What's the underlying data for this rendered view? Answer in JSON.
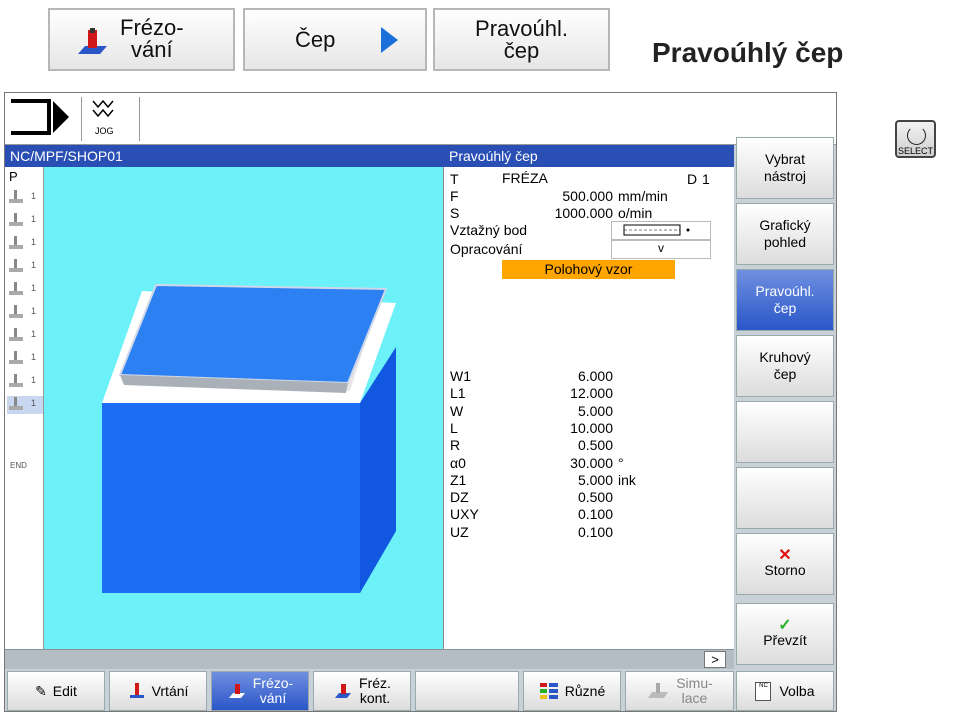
{
  "breadcrumb": {
    "item1": {
      "line1": "Frézo-",
      "line2": "vání"
    },
    "item2": "Čep",
    "item3": {
      "line1": "Pravoúhl.",
      "line2": "čep"
    },
    "title": "Pravoúhlý čep"
  },
  "select_key": {
    "label": "SELECT"
  },
  "topbar": {
    "jog_label": "JOG"
  },
  "header": {
    "path": "NC/MPF/SHOP01",
    "form_title": "Pravoúhlý čep"
  },
  "program_strip": {
    "p_label": "P",
    "end_label": "END",
    "step_numbers": [
      "1",
      "1",
      "1",
      "1",
      "1",
      "1",
      "1",
      "1",
      "1",
      "1"
    ]
  },
  "form": {
    "T": {
      "label": "T",
      "value": "FRÉZA",
      "d_label": "D",
      "d_value": "1"
    },
    "F": {
      "label": "F",
      "value": "500.000",
      "unit": "mm/min"
    },
    "S": {
      "label": "S",
      "value": "1000.000",
      "unit": "o/min"
    },
    "ref_label": "Vztažný bod",
    "machining_label": "Opracování",
    "machining_value": "v",
    "position_pattern": "Polohový vzor",
    "params": [
      {
        "label": "W1",
        "value": "6.000",
        "unit": ""
      },
      {
        "label": "L1",
        "value": "12.000",
        "unit": ""
      },
      {
        "label": "W",
        "value": "5.000",
        "unit": ""
      },
      {
        "label": "L",
        "value": "10.000",
        "unit": ""
      },
      {
        "label": "R",
        "value": "0.500",
        "unit": ""
      },
      {
        "label": "α0",
        "value": "30.000",
        "unit": "°"
      },
      {
        "label": "Z1",
        "value": "5.000",
        "unit": "ink"
      },
      {
        "label": "DZ",
        "value": "0.500",
        "unit": ""
      },
      {
        "label": "UXY",
        "value": "0.100",
        "unit": ""
      },
      {
        "label": "UZ",
        "value": "0.100",
        "unit": ""
      }
    ]
  },
  "status": {
    "more": ">"
  },
  "right_softkeys": [
    {
      "line1": "Vybrat",
      "line2": "nástroj"
    },
    {
      "line1": "Grafický",
      "line2": "pohled"
    },
    {
      "line1": "Pravoúhl.",
      "line2": "čep"
    },
    {
      "line1": "Kruhový",
      "line2": "čep"
    },
    {
      "line1": "",
      "line2": ""
    },
    {
      "line1": "",
      "line2": ""
    },
    {
      "line1": "Storno",
      "line2": ""
    },
    {
      "line1": "Převzít",
      "line2": ""
    }
  ],
  "bottom_softkeys": {
    "edit": "Edit",
    "drill": "Vrtání",
    "mill": {
      "line1": "Frézo-",
      "line2": "vání"
    },
    "contour": {
      "line1": "Fréz.",
      "line2": "kont."
    },
    "misc": "Různé",
    "sim": {
      "line1": "Simu-",
      "line2": "lace"
    },
    "select": "Volba",
    "nc_label": "NC"
  },
  "colors": {
    "header_blue": "#2a4fb4",
    "view_cyan": "#6cf1f8",
    "orange": "#ffa500",
    "active_key": "#2a56c8"
  }
}
